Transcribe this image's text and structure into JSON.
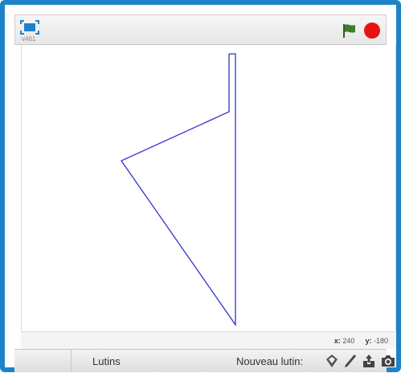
{
  "window": {
    "version_label": "v461",
    "accent_color": "#1e82c8"
  },
  "toolbar": {
    "fullscreen_icon": "fullscreen-icon",
    "green_flag_icon": "green-flag-icon",
    "stop_icon": "stop-icon",
    "flag_color": "#3e7d2c",
    "stop_color": "#e8130f"
  },
  "stage": {
    "pen_color": "#3333cc",
    "drawing_points": [
      [
        258,
        11
      ],
      [
        266,
        11
      ],
      [
        266,
        348
      ],
      [
        124,
        144
      ],
      [
        258,
        83
      ],
      [
        258,
        11
      ]
    ]
  },
  "status": {
    "x_label": "x:",
    "x_value": "240",
    "y_label": "y:",
    "y_value": "-180"
  },
  "sprite_bar": {
    "sprites_label": "Lutins",
    "new_sprite_label": "Nouveau lutin:",
    "icons": [
      "choose-sprite-from-library-icon",
      "paint-new-sprite-icon",
      "upload-sprite-icon",
      "camera-icon"
    ]
  }
}
